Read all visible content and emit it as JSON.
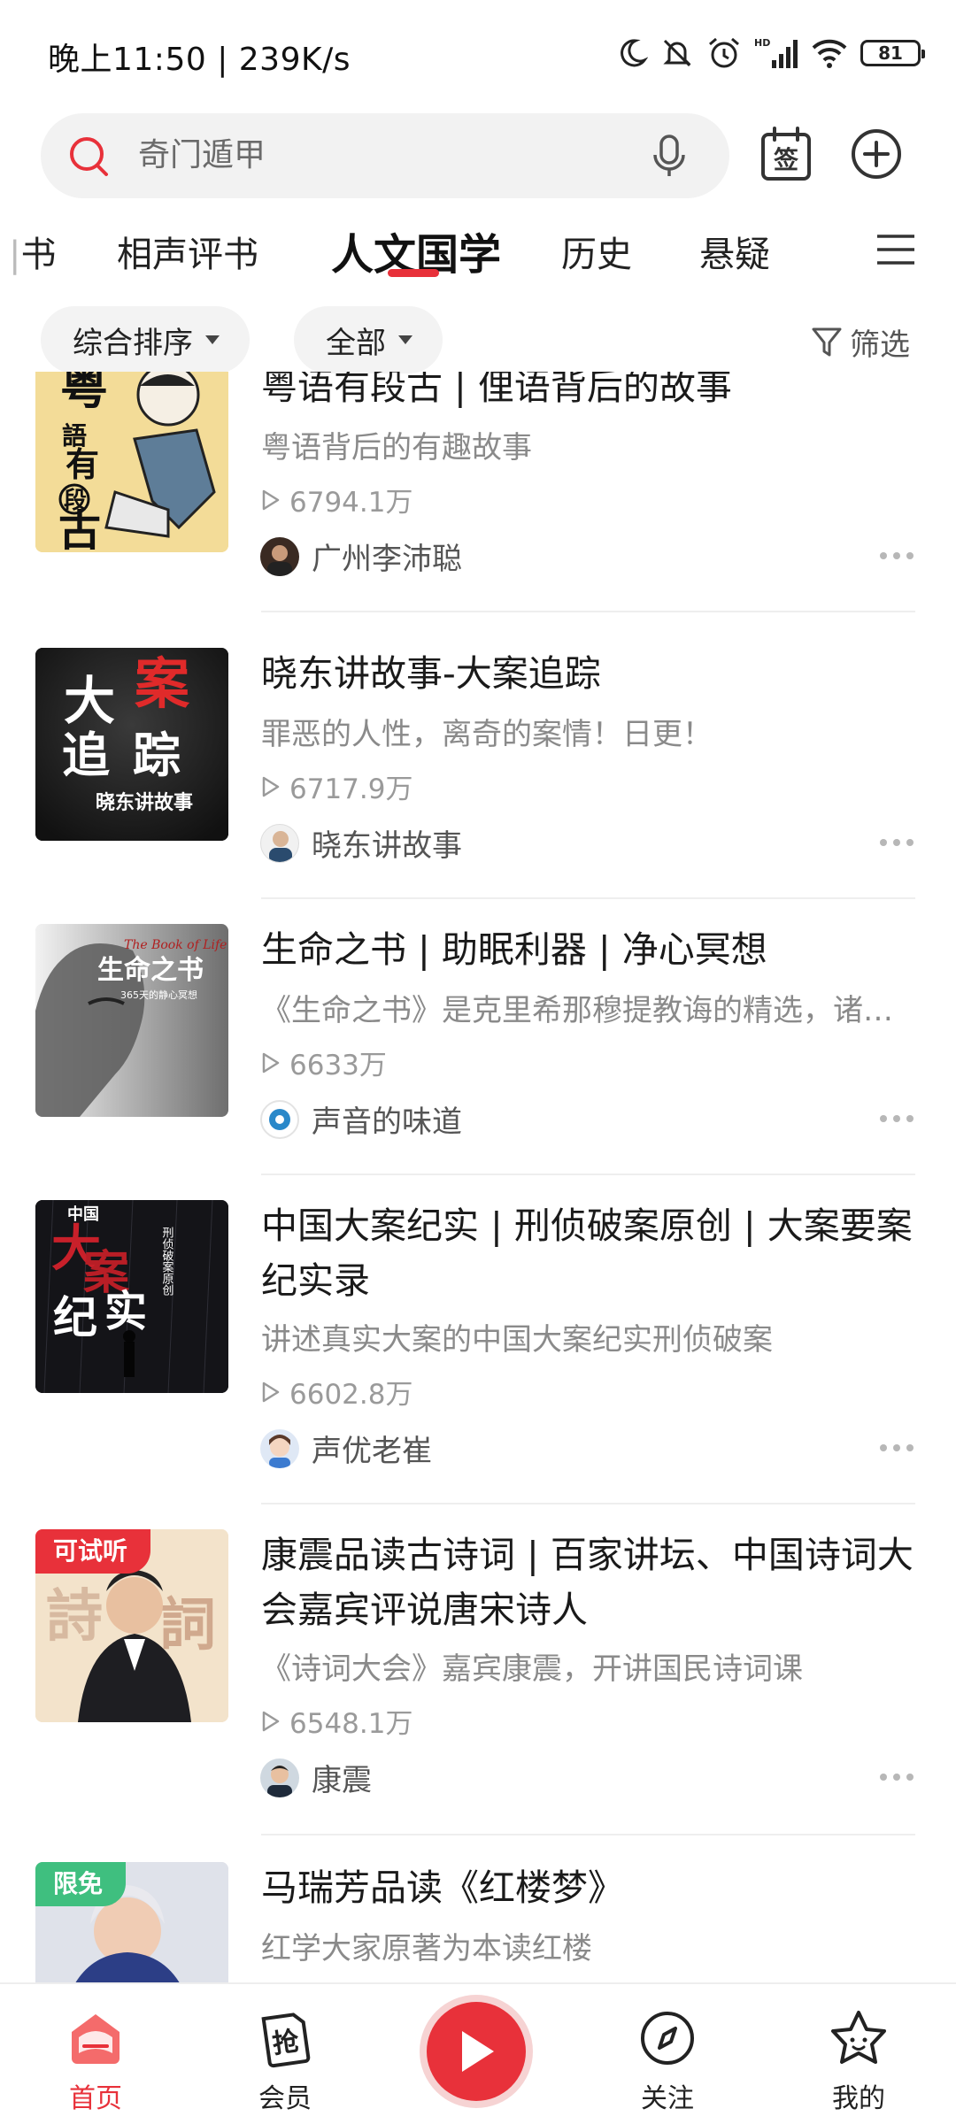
{
  "status_bar": {
    "time_speed": "晚上11:50 | 239K/s",
    "battery": "81",
    "network": "HD"
  },
  "search": {
    "placeholder": "奇门遁甲"
  },
  "header_icons": {
    "sign_in_label": "签"
  },
  "tabs": [
    {
      "label": "书"
    },
    {
      "label": "相声评书"
    },
    {
      "label": "人文国学",
      "active": true
    },
    {
      "label": "历史"
    },
    {
      "label": "悬疑"
    }
  ],
  "filters": {
    "sort_label": "综合排序",
    "scope_label": "全部",
    "filter_label": "筛选"
  },
  "items": [
    {
      "title": "粤语有段古 | 俚语背后的故事",
      "desc": "粤语背后的有趣故事",
      "plays": "6794.1万",
      "author": "广州李沛聪",
      "cover_text": [
        "粤",
        "語",
        "有",
        "段",
        "古"
      ]
    },
    {
      "title": "晓东讲故事-大案追踪",
      "desc": "罪恶的人性，离奇的案情！日更！",
      "plays": "6717.9万",
      "author": "晓东讲故事",
      "cover_text": [
        "大",
        "案",
        "追",
        "踪",
        "晓东讲故事"
      ]
    },
    {
      "title": "生命之书 | 助眠利器 | 净心冥想",
      "desc": "《生命之书》是克里希那穆提教诲的精选，诸…",
      "plays": "6633万",
      "author": "声音的味道",
      "cover_text": [
        "The Book of Life",
        "生命之书",
        "365天的静心冥想"
      ]
    },
    {
      "title": "中国大案纪实 | 刑侦破案原创 | 大案要案纪实录",
      "desc": "讲述真实大案的中国大案纪实刑侦破案",
      "plays": "6602.8万",
      "author": "声优老崔",
      "cover_text": [
        "中国",
        "大",
        "案",
        "纪",
        "实",
        "刑侦破案原创"
      ]
    },
    {
      "title": "康震品读古诗词 | 百家讲坛、中国诗词大会嘉宾评说唐宋诗人",
      "desc": "《诗词大会》嘉宾康震，开讲国民诗词课",
      "plays": "6548.1万",
      "author": "康震",
      "badge": "可试听",
      "cover_text": [
        "詩",
        "詞"
      ]
    },
    {
      "title": "马瑞芳品读《红楼梦》",
      "desc": "红学大家原著为本读红楼",
      "badge": "限免"
    }
  ],
  "bottom_nav": [
    {
      "label": "首页",
      "icon": "home-icon",
      "active": true
    },
    {
      "label": "会员",
      "icon": "vip-grab-icon",
      "glyph": "抢"
    },
    {
      "label": "",
      "icon": "play-icon"
    },
    {
      "label": "关注",
      "icon": "compass-icon"
    },
    {
      "label": "我的",
      "icon": "profile-star-icon"
    }
  ],
  "colors": {
    "accent": "#e8313a",
    "badge_trial": "#e8313a",
    "badge_free": "#3fbf7f"
  }
}
